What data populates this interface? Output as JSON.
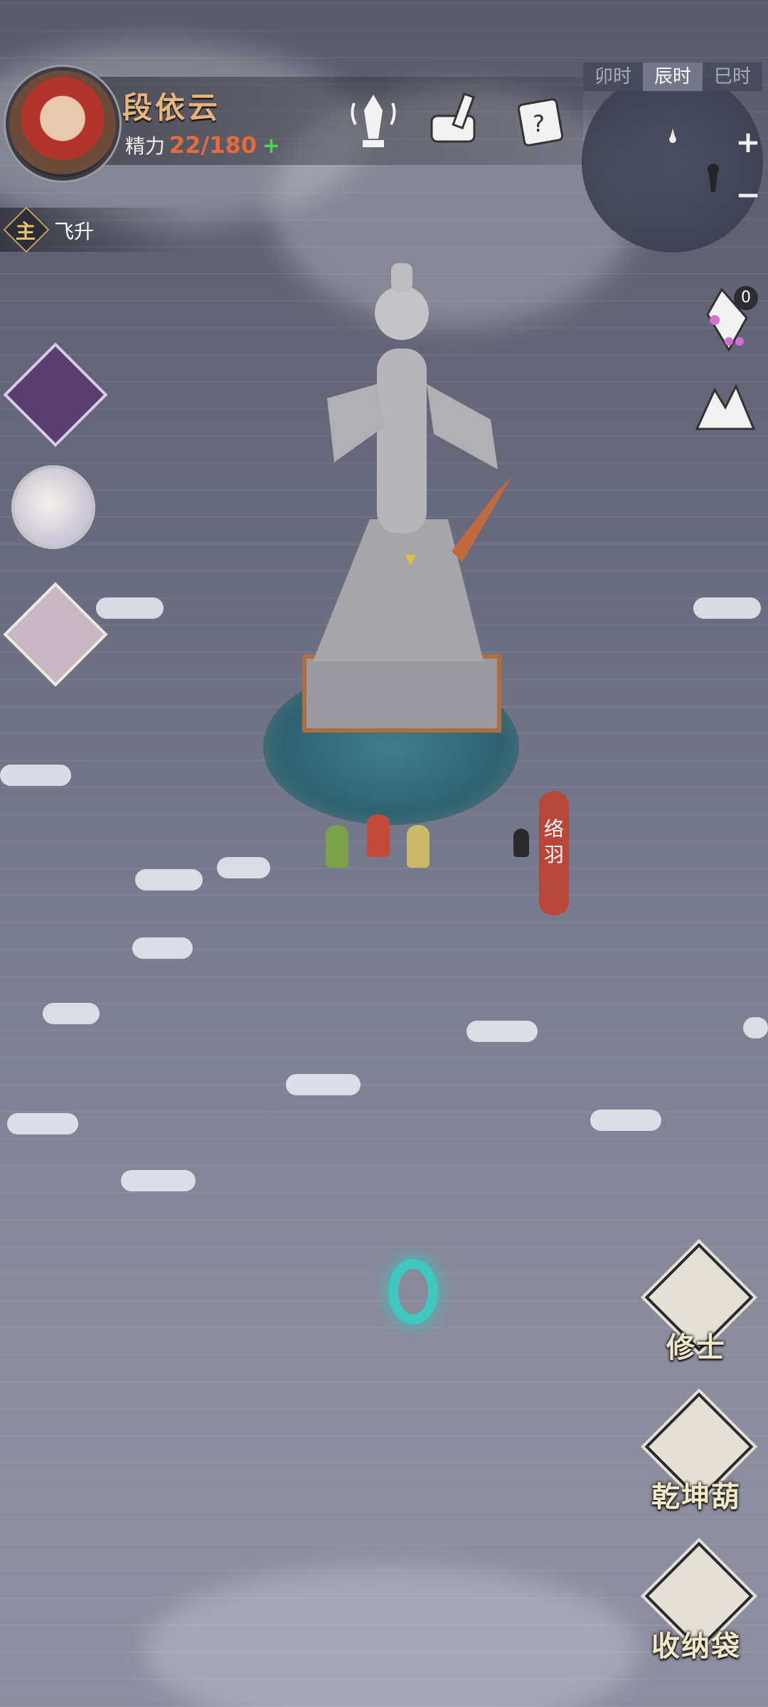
{
  "player": {
    "name": "段依云",
    "energy_label": "精力",
    "energy_current": "22",
    "energy_max": "180",
    "energy_separator": "/",
    "energy_add": "+"
  },
  "top_icons": [
    "tower-marker-icon",
    "scroll-writing-icon",
    "mystery-scroll-icon"
  ],
  "time_tabs": {
    "items": [
      "卯时",
      "辰时",
      "巳时"
    ],
    "active": "辰时"
  },
  "minimap": {
    "zoom_in": "+",
    "zoom_out": "−"
  },
  "quest": {
    "tag": "主",
    "label": "飞升"
  },
  "right_top": {
    "notification_count": "0"
  },
  "npc": {
    "name": "络羽"
  },
  "side_buttons": {
    "cultivator": "修士",
    "gourd": "乾坤葫",
    "bag": "收纳袋"
  },
  "colors": {
    "name": "#e7b47c",
    "energy": "#e36b3c",
    "plus": "#4cd45a",
    "portal": "#3fc7c0",
    "npc_tag": "#b8473a"
  }
}
